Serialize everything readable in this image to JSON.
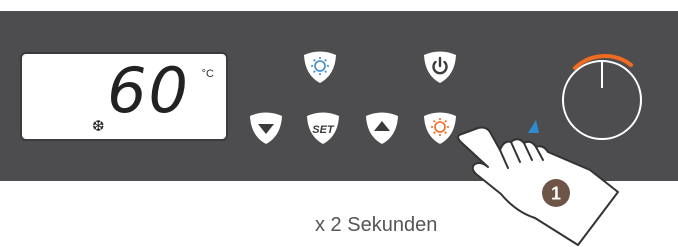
{
  "display": {
    "value": "60",
    "unit": "°C",
    "indicator_icon": "snowflake-icon"
  },
  "buttons": [
    {
      "name": "light-button",
      "icon": "sun-icon",
      "color": "#3d8ad6"
    },
    {
      "name": "power-button",
      "icon": "power-icon"
    },
    {
      "name": "down-button",
      "icon": "chevron-down-icon"
    },
    {
      "name": "set-button",
      "label": "SET"
    },
    {
      "name": "up-button",
      "icon": "chevron-up-icon"
    },
    {
      "name": "light-button-active",
      "icon": "sun-icon",
      "color": "#f06a1f"
    }
  ],
  "step_badge": "1",
  "caption": "x 2 Sekunden",
  "colors": {
    "panel": "#4d4d4f",
    "accent_blue": "#3d8ad6",
    "accent_orange": "#f06a1f",
    "button_fill": "#ffffff"
  }
}
